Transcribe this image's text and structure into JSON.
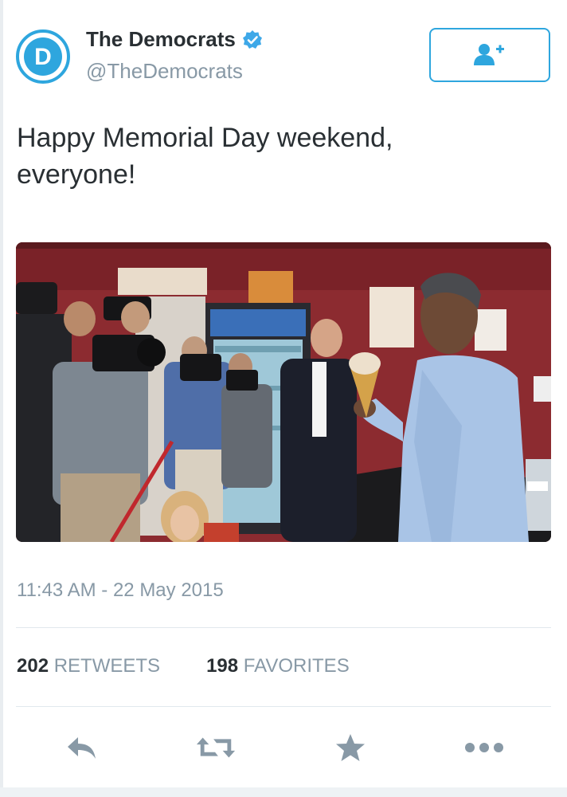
{
  "account": {
    "display_name": "The Democrats",
    "handle": "@TheDemocrats",
    "verified": true,
    "avatar_letter": "D"
  },
  "follow_button": {
    "icon": "follow-user-icon"
  },
  "tweet": {
    "text_line1": "Happy Memorial Day weekend,",
    "text_line2": "everyone!",
    "timestamp": "11:43 AM - 22 May 2015"
  },
  "stats": {
    "retweets_count": "202",
    "retweets_label": "RETWEETS",
    "favorites_count": "198",
    "favorites_label": "FAVORITES"
  },
  "actions": [
    "reply-icon",
    "retweet-icon",
    "favorite-star-icon",
    "more-dots-icon"
  ],
  "colors": {
    "accent": "#2ea6de",
    "text": "#292f33",
    "secondary_text": "#8899a6",
    "action_icon": "#8899a6"
  }
}
